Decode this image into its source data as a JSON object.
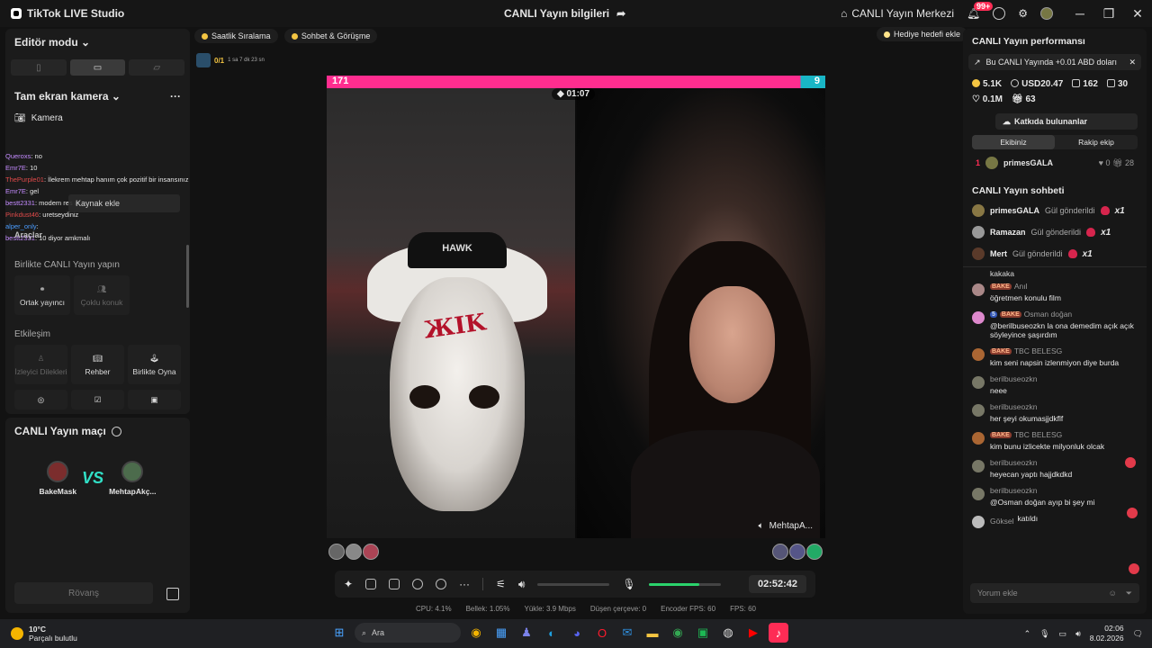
{
  "window": {
    "app_title": "TikTok LIVE Studio",
    "center_title": "CANLI Yayın bilgileri",
    "live_center": "CANLI Yayın Merkezi",
    "notification_count": "99+"
  },
  "left": {
    "mode_label": "Editör modu",
    "camera_section": "Tam ekran kamera",
    "camera_item": "Kamera",
    "add_source": "Kaynak ekle",
    "tools_overlay": "Araçlar",
    "chat": [
      {
        "user": "Queroxs",
        "text": ": no",
        "color": "#c48bff"
      },
      {
        "user": "Emr7E",
        "text": ": 10",
        "color": "#c48bff"
      },
      {
        "user": "ThePurple01",
        "text": ": İlekrem mehtap hanım çok pozitif bir insansınız",
        "color": "#e04a4a"
      },
      {
        "user": "Emr7E",
        "text": ": gel",
        "color": "#c48bff"
      },
      {
        "user": "bestt2331",
        "text": ": modem res at",
        "color": "#c48bff"
      },
      {
        "user": "Pinkdust46",
        "text": ": uretseydiniz",
        "color": "#e04a4a"
      },
      {
        "user": "alper_only",
        "text": ":",
        "color": "#4a9cff"
      },
      {
        "user": "bestt2331",
        "text": ": 10 diyor amkmalı",
        "color": "#c48bff"
      }
    ],
    "together_title": "Birlikte CANLI Yayın yapın",
    "together_tiles": [
      "Ortak yayıncı",
      "Çoklu konuk"
    ],
    "interaction_title": "Etkileşim",
    "interaction_tiles": [
      "İzleyici Dilekleri",
      "Rehber",
      "Birlikte Oyna"
    ],
    "match_title": "CANLI Yayın maçı",
    "players": [
      "BakeMask",
      "MehtapAkç..."
    ],
    "vs": "VS",
    "rematch": "Rövanş"
  },
  "center": {
    "pills": [
      "Saatlik Sıralama",
      "Sohbet & Görüşme"
    ],
    "gift_goal": "Hediye hedefi ekle",
    "mini_count": "0/1",
    "mini_time": "1 sa 7 dk 23 sn",
    "pk_left": "171",
    "pk_right": "9",
    "timer": "01:07",
    "right_name": "MehtapA...",
    "mask_text": "HAWK",
    "elapsed": "02:52:42",
    "volume_level": 0.7,
    "stats": [
      "CPU: 4.1%",
      "Bellek: 1.05%",
      "Yükle: 3.9 Mbps",
      "Düşen çerçeve: 0",
      "Encoder FPS: 60",
      "FPS: 60"
    ]
  },
  "right": {
    "perf_title": "CANLI Yayın performansı",
    "earn_text": "Bu CANLI Yayında +0.01 ABD doları",
    "metrics": [
      "5.1K",
      "USD20.47",
      "162",
      "30",
      "0.1M",
      "63"
    ],
    "contributors": "Katkıda bulunanlar",
    "tabs": [
      "Ekibiniz",
      "Rakip ekip"
    ],
    "rank": {
      "num": "1",
      "name": "primesGALA",
      "likes": "0",
      "gifts": "28"
    },
    "chat_title": "CANLI Yayın sohbeti",
    "gift_suffix": "Gül gönderildi",
    "gifts": [
      {
        "user": "primesGALA",
        "mult": "x1"
      },
      {
        "user": "Ramazan",
        "mult": "x1"
      },
      {
        "user": "Mert",
        "mult": "x1"
      }
    ],
    "scrolled_text": "kakaka",
    "messages": [
      {
        "user": "Anıl",
        "tag": "BAKE",
        "text": "öğretmen konulu film"
      },
      {
        "user": "Osman doğan",
        "tag": "BAKE",
        "level": "5",
        "text": "@berilbuseozkn la ona demedim açık açık söyleyince şaşırdım"
      },
      {
        "user": "TBC BELESG",
        "tag": "BAKE",
        "text": "kim seni napsin izlenmiyon diye burda"
      },
      {
        "user": "berilbuseozkn",
        "tag": "",
        "text": "neee"
      },
      {
        "user": "berilbuseozkn",
        "tag": "",
        "text": "her şeyi okumasjjdkflf"
      },
      {
        "user": "TBC BELESG",
        "tag": "BAKE",
        "text": "kim bunu izlicekte milyonluk olcak"
      },
      {
        "user": "berilbuseozkn",
        "tag": "",
        "text": "heyecan yaptı hajjdkdkd"
      },
      {
        "user": "berilbuseozkn",
        "tag": "",
        "text": "@Osman doğan ayıp bi şey mi"
      }
    ],
    "joined": {
      "user": "Göksel",
      "text": "katıldı"
    },
    "reply_placeholder": "Yorum ekle"
  },
  "taskbar": {
    "temp": "10°C",
    "weather": "Parçalı bulutlu",
    "search": "Ara",
    "time": "02:06",
    "date": "8.02.2026"
  }
}
